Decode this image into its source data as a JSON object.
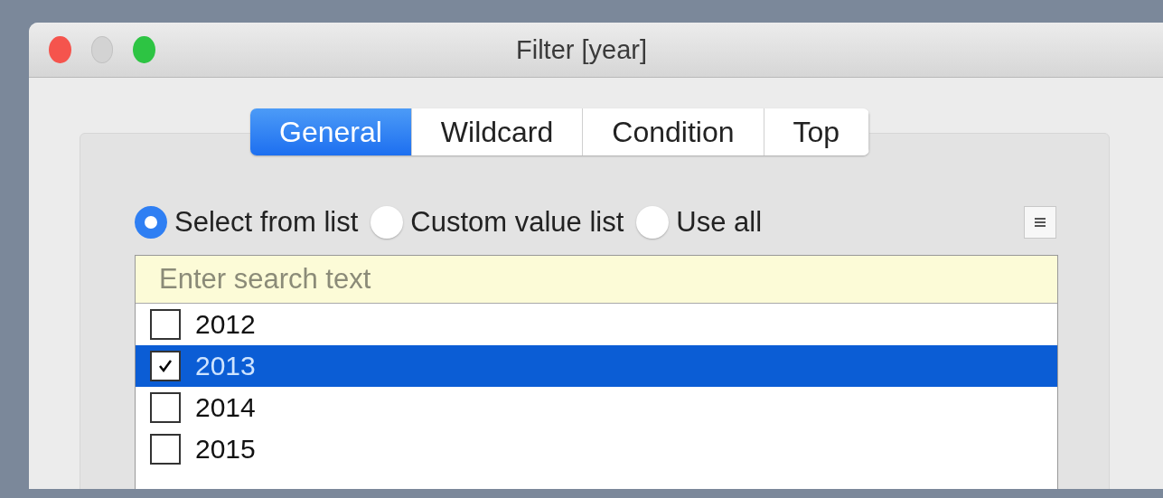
{
  "window": {
    "title": "Filter [year]"
  },
  "tabs": [
    {
      "label": "General",
      "selected": true
    },
    {
      "label": "Wildcard",
      "selected": false
    },
    {
      "label": "Condition",
      "selected": false
    },
    {
      "label": "Top",
      "selected": false
    }
  ],
  "modes": [
    {
      "label": "Select from list",
      "selected": true
    },
    {
      "label": "Custom value list",
      "selected": false
    },
    {
      "label": "Use all",
      "selected": false
    }
  ],
  "search": {
    "placeholder": "Enter search text"
  },
  "items": [
    {
      "label": "2012",
      "checked": false,
      "selected": false
    },
    {
      "label": "2013",
      "checked": true,
      "selected": true
    },
    {
      "label": "2014",
      "checked": false,
      "selected": false
    },
    {
      "label": "2015",
      "checked": false,
      "selected": false
    }
  ]
}
